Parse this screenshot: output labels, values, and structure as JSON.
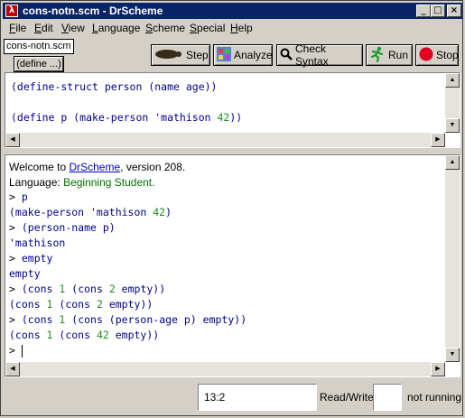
{
  "window": {
    "title": "cons-notn.scm - DrScheme"
  },
  "menu": [
    {
      "label": "File",
      "u": "F",
      "rest": "ile"
    },
    {
      "label": "Edit",
      "u": "E",
      "rest": "dit"
    },
    {
      "label": "View",
      "u": "V",
      "rest": "iew"
    },
    {
      "label": "Language",
      "u": "L",
      "rest": "anguage"
    },
    {
      "label": "Scheme",
      "u": "S",
      "rest": "cheme"
    },
    {
      "label": "Special",
      "u": "S",
      "rest": "pecial"
    },
    {
      "label": "Help",
      "u": "H",
      "rest": "elp"
    }
  ],
  "tab": {
    "filename": "cons-notn.scm"
  },
  "define_button": "(define ...)",
  "toolbar": {
    "step": "Step",
    "analyze": "Analyze",
    "check_syntax": "Check Syntax",
    "run": "Run",
    "stop": "Stop"
  },
  "definitions": {
    "line1": "(define-struct person (name age))",
    "line2_prefix": "(define p (make-person 'mathison ",
    "line2_num": "42",
    "line2_suffix": "))"
  },
  "interactions": {
    "welcome_prefix": "Welcome to ",
    "welcome_link": "DrScheme",
    "welcome_suffix": ", version 208.",
    "language_label": "Language: ",
    "language_value": "Beginning Student.",
    "lines": [
      {
        "kind": "prompt",
        "text": "> p"
      },
      {
        "kind": "output",
        "text": "(make-person 'mathison 42)"
      },
      {
        "kind": "prompt",
        "text": "> (person-name p)"
      },
      {
        "kind": "output",
        "text": "'mathison"
      },
      {
        "kind": "prompt",
        "text": "> empty"
      },
      {
        "kind": "output",
        "text": "empty"
      },
      {
        "kind": "prompt",
        "text": "> (cons 1 (cons 2 empty))"
      },
      {
        "kind": "output",
        "text": "(cons 1 (cons 2 empty))"
      },
      {
        "kind": "prompt",
        "text": "> (cons 1 (cons (person-age p) empty))"
      },
      {
        "kind": "output",
        "text": "(cons 1 (cons 42 empty))"
      },
      {
        "kind": "prompt",
        "text": "> "
      }
    ]
  },
  "status": {
    "position": "13:2",
    "mode": "Read/Write",
    "running": "not running"
  }
}
